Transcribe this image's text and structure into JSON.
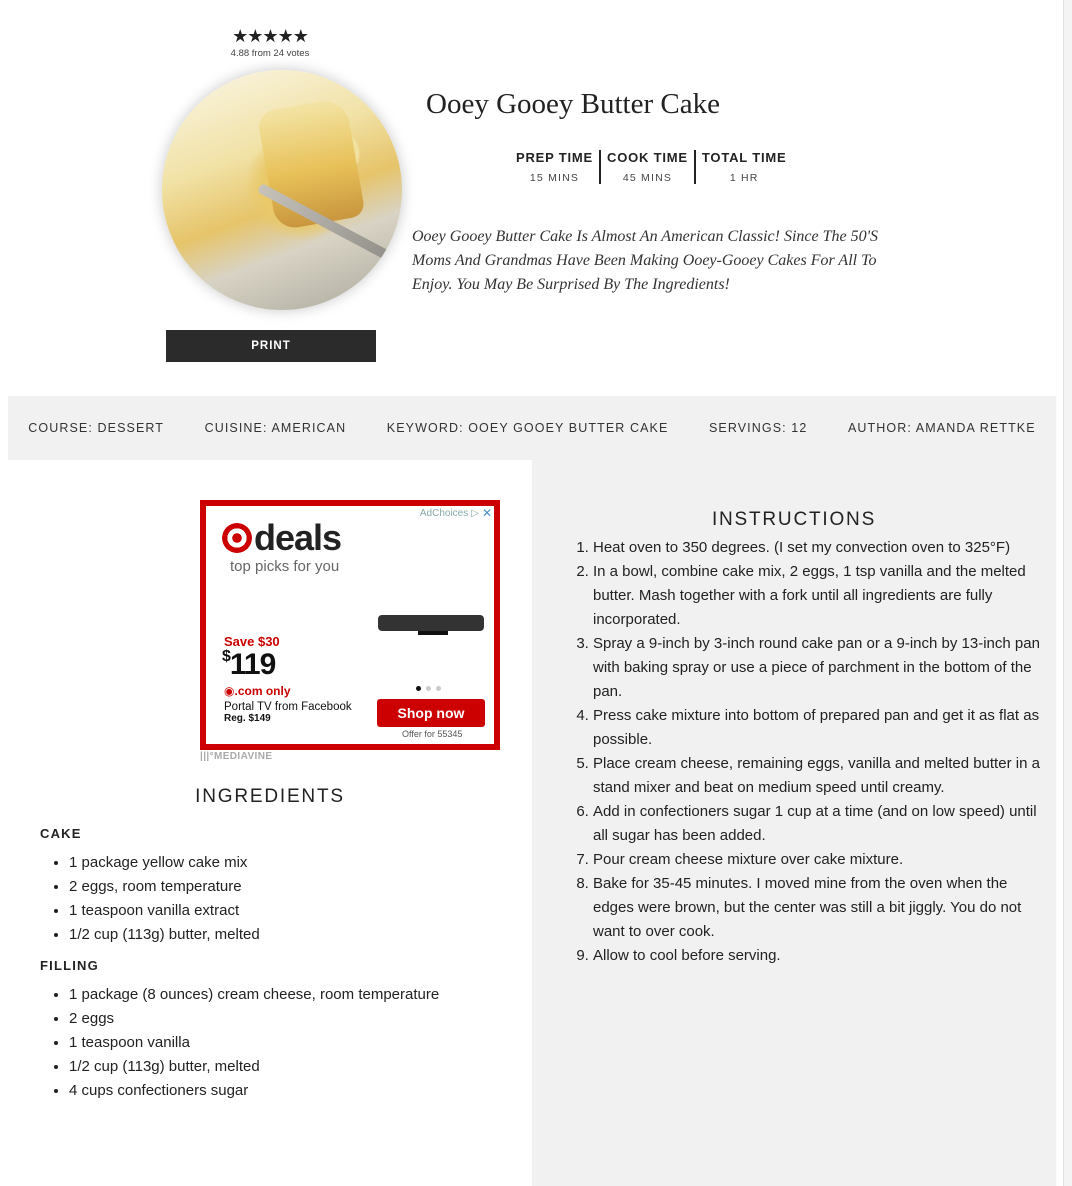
{
  "rating": {
    "stars": "★★★★★",
    "value": 4.88,
    "votes_text": "4.88 from 24 votes"
  },
  "photo": {
    "alt": "Ooey Gooey Butter Cake"
  },
  "print_label": "PRINT",
  "recipe": {
    "title": "Ooey Gooey Butter Cake",
    "summary": "Ooey Gooey Butter Cake Is Almost An American Classic! Since The 50'S Moms And Grandmas Have Been Making Ooey-Gooey Cakes For All To Enjoy. You May Be Surprised By The Ingredients!"
  },
  "times": {
    "prep": {
      "label": "PREP TIME",
      "value": "15 MINS"
    },
    "cook": {
      "label": "COOK TIME",
      "value": "45 MINS"
    },
    "total": {
      "label": "TOTAL TIME",
      "value": "1 HR"
    }
  },
  "meta": {
    "course": "COURSE: DESSERT",
    "cuisine": "CUISINE: AMERICAN",
    "keyword": "KEYWORD: OOEY GOOEY BUTTER CAKE",
    "servings": "SERVINGS: 12",
    "author": "AUTHOR: AMANDA RETTKE"
  },
  "ad": {
    "adchoices": "AdChoices",
    "brand": "deals",
    "tagline": "top picks for you",
    "save": "Save $30",
    "price_symbol": "$",
    "price_amount": "119",
    "dotcom": ".com only",
    "product_name": "Portal TV from Facebook",
    "regular_price": "Reg. $149",
    "cta": "Shop now",
    "offer": "Offer for 55345",
    "network": "MEDIAVINE",
    "brand_color": "#cc0000"
  },
  "ingredients": {
    "heading": "INGREDIENTS",
    "groups": [
      {
        "title": "CAKE",
        "items": [
          "1 package yellow cake mix",
          "2 eggs, room temperature",
          "1 teaspoon vanilla extract",
          "1/2 cup (113g) butter, melted"
        ]
      },
      {
        "title": "FILLING",
        "items": [
          "1 package (8 ounces) cream cheese, room temperature",
          "2 eggs",
          "1 teaspoon vanilla",
          "1/2 cup (113g) butter, melted",
          "4 cups confectioners sugar"
        ]
      }
    ]
  },
  "instructions": {
    "heading": "INSTRUCTIONS",
    "steps": [
      "Heat oven to 350 degrees. (I set my convection oven to 325°F)",
      "In a bowl, combine cake mix, 2 eggs, 1 tsp vanilla and the melted butter. Mash together with a fork until all ingredients are fully incorporated.",
      "Spray a 9-inch by 3-inch round cake pan or a 9-inch by 13-inch pan with baking spray or use a piece of parchment in the bottom of the pan.",
      "Press cake mixture into bottom of prepared pan and get it as flat as possible.",
      "Place cream cheese, remaining eggs, vanilla and melted butter in a stand mixer and beat on medium speed until creamy.",
      "Add in confectioners sugar 1 cup at a time (and on low speed) until all sugar has been added.",
      "Pour cream cheese mixture over cake mixture.",
      "Bake for 35-45 minutes. I moved mine from the oven when the edges were brown, but the center was still a bit jiggly. You do not want to over cook.",
      "Allow to cool before serving."
    ]
  }
}
